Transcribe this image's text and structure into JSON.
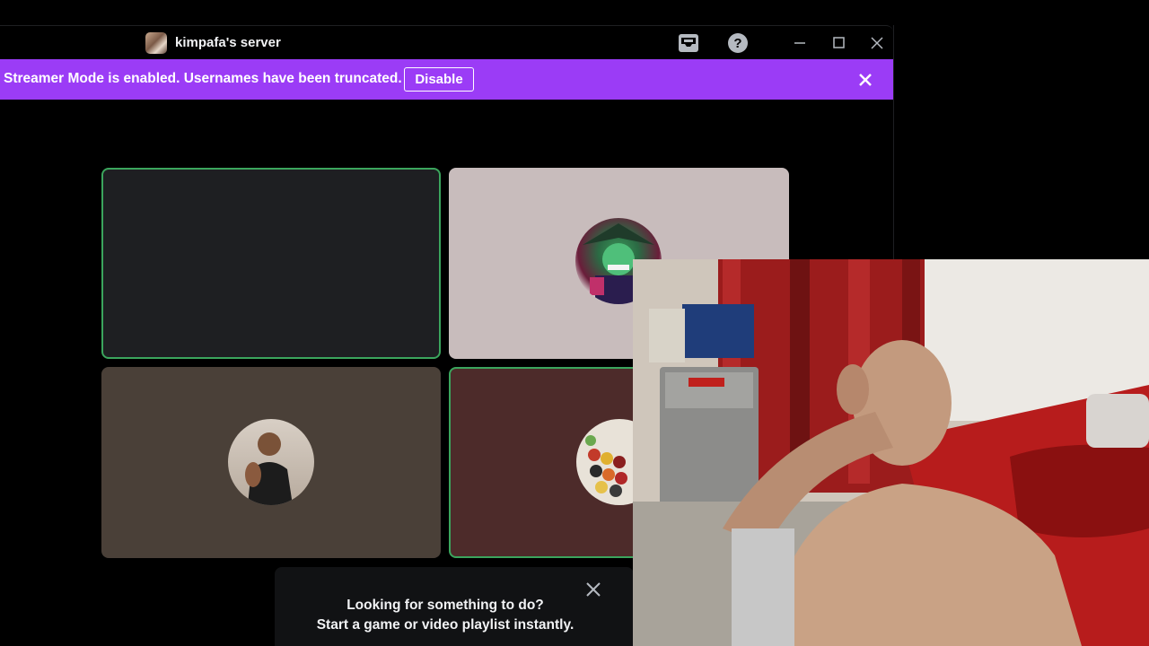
{
  "window": {
    "server_name": "kimpafa's server",
    "titlebar_icons": [
      "inbox-icon",
      "help-icon"
    ],
    "window_controls": [
      "minimize-icon",
      "maximize-icon",
      "close-icon"
    ]
  },
  "banner": {
    "text": "Streamer Mode is enabled. Usernames have been truncated.",
    "disable_label": "Disable",
    "color": "#9b3cf6"
  },
  "voice_grid": {
    "tiles": [
      {
        "id": "tile-1",
        "speaking": true,
        "avatar": "none",
        "background": "#1e1f22"
      },
      {
        "id": "tile-2",
        "speaking": false,
        "avatar": "masked-character-avatar",
        "background": "#c8bcbc"
      },
      {
        "id": "tile-3",
        "speaking": false,
        "avatar": "person-avatar",
        "background": "#4a4038"
      },
      {
        "id": "tile-4",
        "speaking": true,
        "avatar": "beads-avatar",
        "background": "#4d2b2a"
      }
    ],
    "speaking_color": "#3ba55d"
  },
  "activity_card": {
    "line1": "Looking for something to do?",
    "line2": "Start a game or video playlist instantly."
  },
  "webcam_overlay": {
    "label": "webcam-feed"
  }
}
